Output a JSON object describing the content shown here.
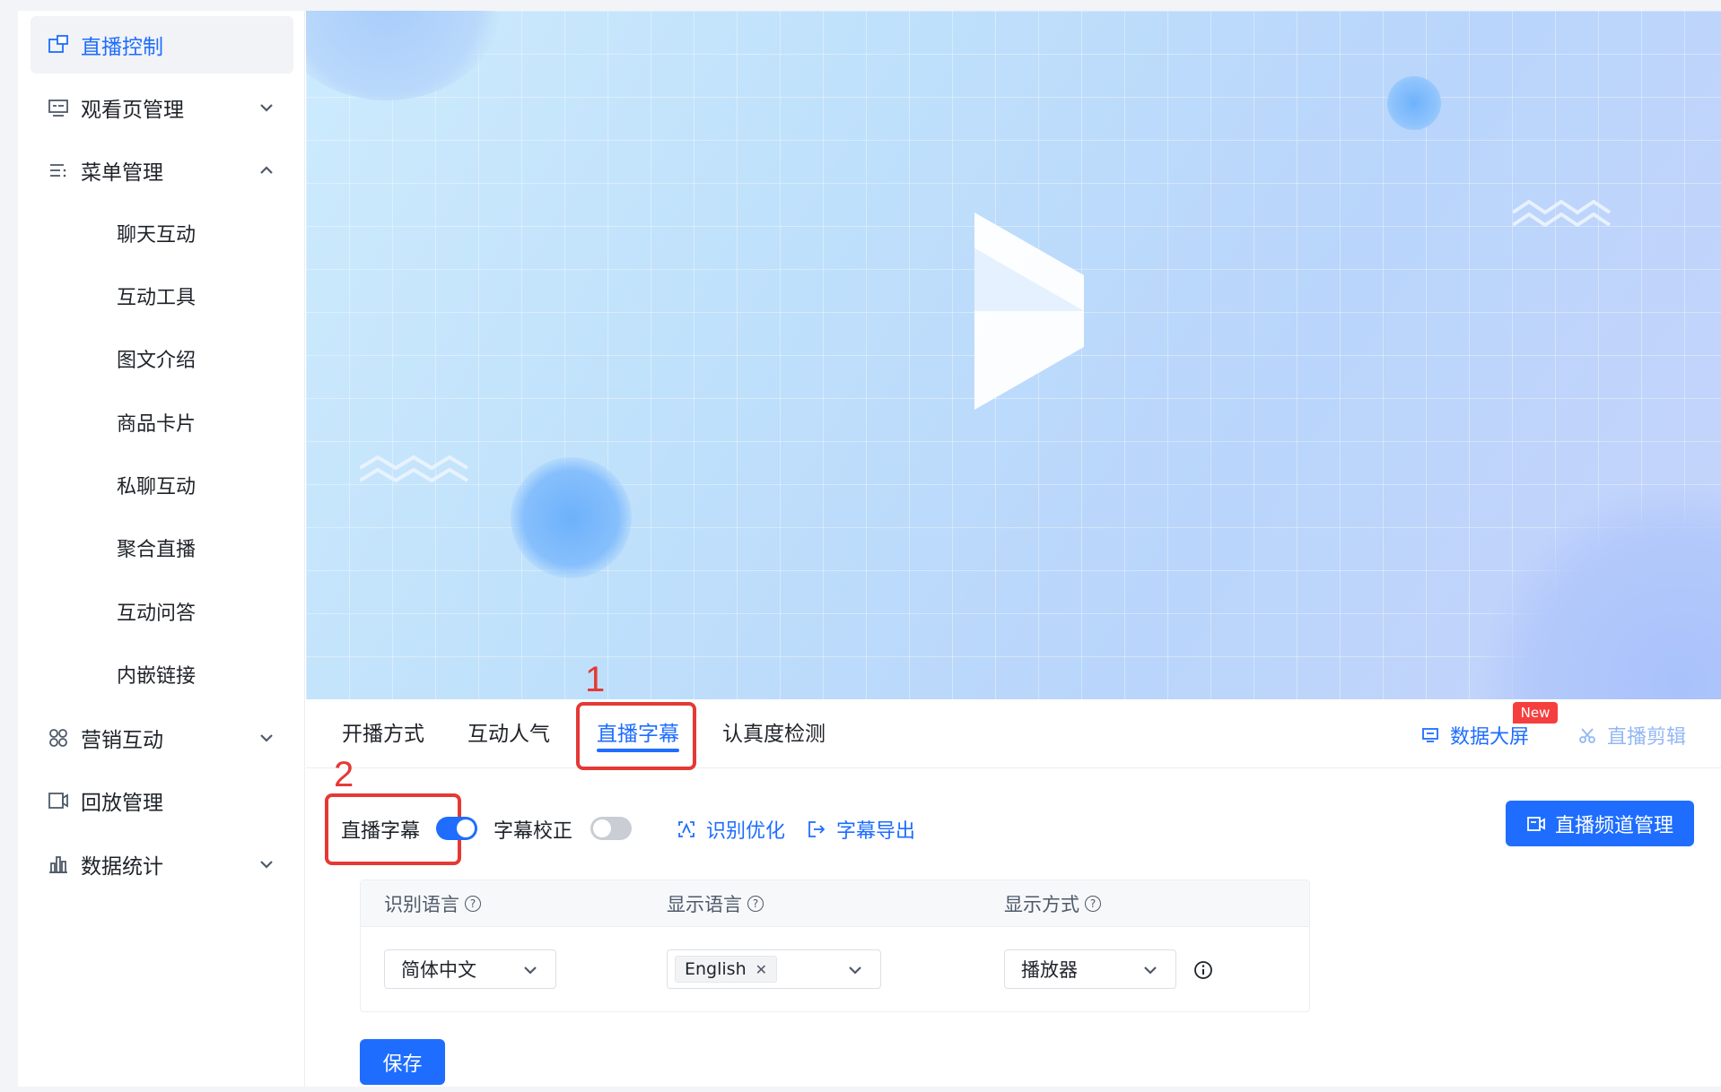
{
  "sidebar": {
    "items": [
      {
        "label": "直播控制",
        "icon": "live-control-icon"
      },
      {
        "label": "观看页管理",
        "icon": "watch-page-icon"
      },
      {
        "label": "菜单管理",
        "icon": "menu-list-icon"
      },
      {
        "label": "营销互动",
        "icon": "marketing-grid-icon"
      },
      {
        "label": "回放管理",
        "icon": "playback-icon"
      },
      {
        "label": "数据统计",
        "icon": "bar-chart-icon"
      }
    ],
    "sub_items": [
      "聊天互动",
      "互动工具",
      "图文介绍",
      "商品卡片",
      "私聊互动",
      "聚合直播",
      "互动问答",
      "内嵌链接"
    ]
  },
  "tabs": [
    {
      "label": "开播方式"
    },
    {
      "label": "互动人气"
    },
    {
      "label": "直播字幕"
    },
    {
      "label": "认真度检测"
    }
  ],
  "tab_links": {
    "data_screen": "数据大屏",
    "new_badge": "New",
    "live_clip": "直播剪辑"
  },
  "annotations": {
    "num1": "1",
    "num2": "2"
  },
  "subtitle_settings": {
    "live_subtitle_label": "直播字幕",
    "live_subtitle_on": true,
    "correction_label": "字幕校正",
    "correction_on": false,
    "recognition_optimize": "识别优化",
    "subtitle_export": "字幕导出",
    "channel_manage_button": "直播频道管理"
  },
  "table": {
    "headers": [
      "识别语言",
      "显示语言",
      "显示方式"
    ],
    "recognition_language": "简体中文",
    "display_language_tag": "English",
    "display_mode": "播放器"
  },
  "save_button": "保存",
  "colors": {
    "accent": "#1e6dff",
    "annotation": "#e53935",
    "badge": "#f53f3f"
  }
}
